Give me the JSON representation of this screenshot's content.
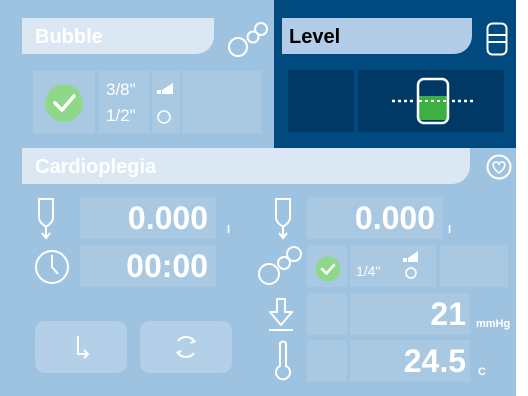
{
  "colors": {
    "panel_bg": "#9ec3e0",
    "header_bg": "#dbe8f4",
    "cell_bg": "#a9c9e3",
    "accent": "#004a80",
    "check_green": "#7fd27d"
  },
  "bubble": {
    "title": "Bubble",
    "icon": "bubbles-icon",
    "status_icon": "check-icon",
    "size_top": "3/8\"",
    "size_bottom": "1/2\""
  },
  "level": {
    "title": "Level",
    "icon": "level-sensor-icon",
    "status": "ok"
  },
  "cardioplegia": {
    "title": "Cardioplegia",
    "icon": "heart-icon",
    "volume_left": {
      "value": "0.000",
      "unit": "l"
    },
    "volume_right": {
      "value": "0.000",
      "unit": "l"
    },
    "timer": {
      "value": "00:00"
    },
    "bubble_size": "1/4\"",
    "pressure": {
      "value": "21",
      "unit": "mmHg"
    },
    "temperature": {
      "value": "24.5",
      "unit": "C"
    }
  }
}
